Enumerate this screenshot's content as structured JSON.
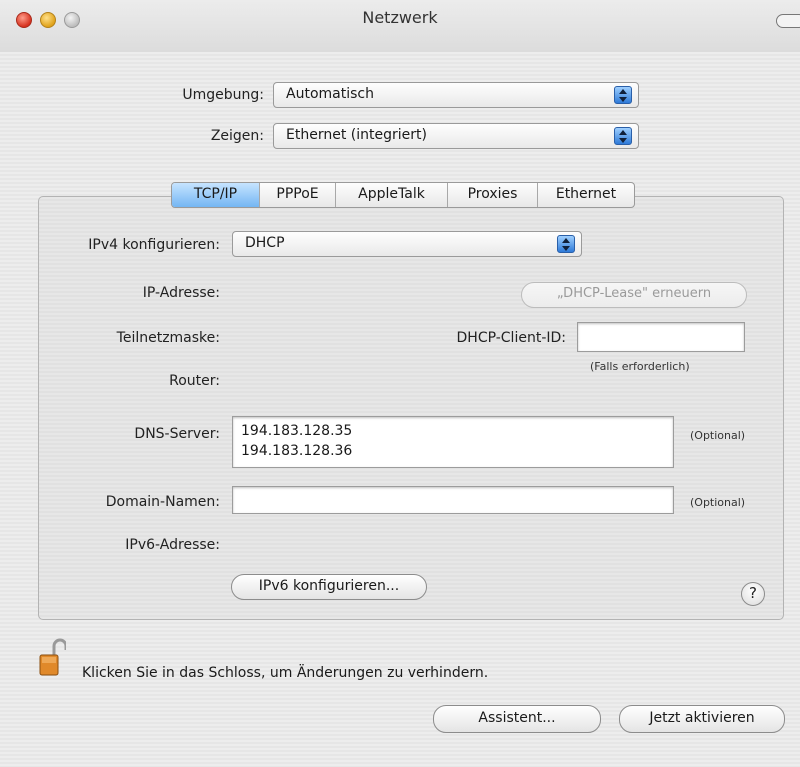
{
  "window": {
    "title": "Netzwerk"
  },
  "location": {
    "label": "Umgebung:",
    "value": "Automatisch"
  },
  "show": {
    "label": "Zeigen:",
    "value": "Ethernet (integriert)"
  },
  "tabs": [
    {
      "label": "TCP/IP",
      "active": true
    },
    {
      "label": "PPPoE",
      "active": false
    },
    {
      "label": "AppleTalk",
      "active": false
    },
    {
      "label": "Proxies",
      "active": false
    },
    {
      "label": "Ethernet",
      "active": false
    }
  ],
  "ipv4": {
    "label": "IPv4 konfigurieren:",
    "value": "DHCP"
  },
  "ip_address": {
    "label": "IP-Adresse:"
  },
  "renew_lease_button": "„DHCP-Lease\" erneuern",
  "subnet": {
    "label": "Teilnetzmaske:"
  },
  "dhcp_client_id": {
    "label": "DHCP-Client-ID:",
    "value": "",
    "hint": "(Falls erforderlich)"
  },
  "router": {
    "label": "Router:"
  },
  "dns": {
    "label": "DNS-Server:",
    "servers": [
      "194.183.128.35",
      "194.183.128.36"
    ],
    "optional": "(Optional)"
  },
  "domains": {
    "label": "Domain-Namen:",
    "value": "",
    "optional": "(Optional)"
  },
  "ipv6": {
    "label": "IPv6-Adresse:",
    "button": "IPv6 konfigurieren..."
  },
  "help": "?",
  "lock": {
    "text": "Klicken Sie in das Schloss, um Änderungen zu verhindern."
  },
  "buttons": {
    "assistant": "Assistent...",
    "apply": "Jetzt aktivieren"
  },
  "colors": {
    "accent": "#74b6f3",
    "stepper": "#2e7ad8"
  }
}
